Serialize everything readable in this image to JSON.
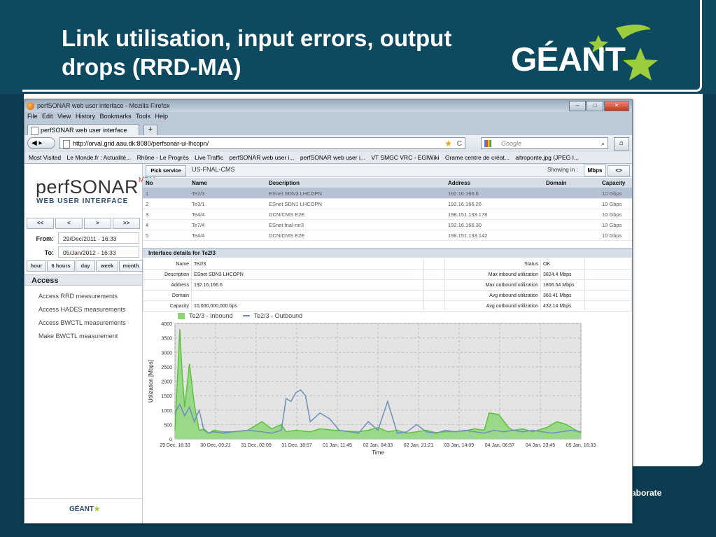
{
  "slide": {
    "title_line1": "Link utilisation, input errors, output",
    "title_line2": "drops (RRD-MA)",
    "logo": "GÉANT",
    "footer_fragment": "aborate"
  },
  "browser": {
    "window_title": "perfSONAR web user interface - Mozilla Firefox",
    "menu": [
      "File",
      "Edit",
      "View",
      "History",
      "Bookmarks",
      "Tools",
      "Help"
    ],
    "tab_label": "perfSONAR web user interface",
    "new_tab": "+",
    "url": "http://orval.grid.aau.dk:8080/perfsonar-ui-lhcopn/",
    "search_placeholder": "Google",
    "bookmarks": [
      "Most Visited",
      "Le Monde.fr : Actualité...",
      "Rhône - Le Progrès",
      "Live Traffic",
      "perfSONAR web user i...",
      "perfSONAR web user i...",
      "VT SMGC VRC - EGIWiki",
      "Grame centre de créat...",
      "altroponte.jpg (JPEG I..."
    ]
  },
  "sidebar": {
    "brand": "perfSONAR",
    "brand_sup": "MDM",
    "subtitle": "WEB USER INTERFACE",
    "nav": [
      "<<",
      "<",
      ">",
      ">>"
    ],
    "from_label": "From:",
    "from_value": "29/Dec/2011 - 16:33",
    "to_label": "To:",
    "to_value": "05/Jan/2012 - 16:33",
    "ranges": [
      "hour",
      "6 hours",
      "day",
      "week",
      "month"
    ],
    "access_title": "Access",
    "access_items": [
      "Access RRD measurements",
      "Access HADES measurements",
      "Access BWCTL measurements",
      "Make BWCTL measurement"
    ],
    "footer_logo": "GÉANT"
  },
  "service": {
    "pick_label": "Pick service",
    "name": "US-FNAL-CMS",
    "showing_label": "Showing in :",
    "unit": "Mbps",
    "swap": "<>"
  },
  "interfaces": {
    "headers": [
      "No",
      "Name",
      "Description",
      "Address",
      "Domain",
      "Capacity"
    ],
    "rows": [
      [
        "1",
        "Te2/3",
        "ESnet SDN3 LHCOPN",
        "192.16.166.6",
        "",
        "10 Gbps"
      ],
      [
        "2",
        "Te3/1",
        "ESnet SDN1 LHCOPN",
        "192.16.166.26",
        "",
        "10 Gbps"
      ],
      [
        "3",
        "Te4/4",
        "DCN/CMS E2E",
        "198.151.133.178",
        "",
        "10 Gbps"
      ],
      [
        "4",
        "Te7/4",
        "ESnet fnal-mr3",
        "192.16.166.30",
        "",
        "10 Gbps"
      ],
      [
        "5",
        "Te4/4",
        "DCN/CMS E2E",
        "198.151.133.142",
        "",
        "10 Gbps"
      ]
    ]
  },
  "details": {
    "title": "Interface details for Te2/3",
    "left": [
      {
        "k": "Name",
        "v": "Te2/3"
      },
      {
        "k": "Description",
        "v": "ESnet SDN3 LHCOPN"
      },
      {
        "k": "Address",
        "v": "192.16.166.6"
      },
      {
        "k": "Domain",
        "v": ""
      },
      {
        "k": "Capacity",
        "v": "10,000,000,000 bps"
      }
    ],
    "right": [
      {
        "k": "Status",
        "v": "OK"
      },
      {
        "k": "Max inbound utilization",
        "v": "3824.4 Mbps"
      },
      {
        "k": "Max outbound utilization",
        "v": "1806.54 Mbps"
      },
      {
        "k": "Avg inbound utilization",
        "v": "360.41 Mbps"
      },
      {
        "k": "Avg outbound utilization",
        "v": "432.14 Mbps"
      }
    ]
  },
  "chart_data": {
    "type": "area",
    "ylabel": "Utilization [Mbps]",
    "xlabel": "Time",
    "ylim": [
      0,
      4000
    ],
    "yticks": [
      0,
      500,
      1000,
      1500,
      2000,
      2500,
      3000,
      3500,
      4000
    ],
    "xticks": [
      "29 Dec, 16:33",
      "30 Dec, 09:21",
      "31 Dec, 02:09",
      "31 Dec, 18:57",
      "01 Jan, 11:45",
      "02 Jan, 04:33",
      "02 Jan, 21:21",
      "03 Jan, 14:09",
      "04 Jan, 06:57",
      "04 Jan, 23:45",
      "05 Jan, 16:33"
    ],
    "grid": true,
    "colors": {
      "inbound": "#5cc23a",
      "inbound_fill": "#9ad88a",
      "outbound": "#6f8fb8",
      "plot_bg": "#e4e4e4"
    },
    "series": [
      {
        "name": "Te2/3 - Inbound",
        "x_hours": [
          0,
          2,
          3,
          4,
          6,
          8,
          10,
          12,
          14,
          16,
          20,
          24,
          30,
          36,
          40,
          44,
          46,
          50,
          56,
          60,
          66,
          70,
          76,
          80,
          84,
          88,
          92,
          96,
          100,
          104,
          108,
          112,
          116,
          120,
          124,
          128,
          130,
          134,
          138,
          140,
          144,
          148,
          150,
          154,
          158,
          162,
          166,
          168
        ],
        "values": [
          300,
          3800,
          2200,
          1100,
          2600,
          1200,
          300,
          350,
          200,
          300,
          250,
          250,
          300,
          600,
          350,
          500,
          250,
          300,
          250,
          350,
          300,
          280,
          250,
          300,
          400,
          250,
          300,
          200,
          250,
          300,
          220,
          250,
          260,
          280,
          350,
          300,
          900,
          850,
          400,
          300,
          350,
          250,
          300,
          400,
          600,
          500,
          300,
          200
        ]
      },
      {
        "name": "Te2/3 - Outbound",
        "x_hours": [
          0,
          2,
          4,
          6,
          8,
          10,
          12,
          14,
          16,
          20,
          24,
          30,
          36,
          40,
          44,
          46,
          48,
          50,
          52,
          54,
          56,
          60,
          64,
          68,
          72,
          76,
          80,
          84,
          88,
          92,
          96,
          100,
          104,
          108,
          112,
          116,
          120,
          124,
          128,
          132,
          136,
          140,
          144,
          148,
          152,
          156,
          160,
          164,
          168
        ],
        "values": [
          900,
          1200,
          800,
          1100,
          600,
          1000,
          300,
          200,
          250,
          200,
          250,
          300,
          250,
          200,
          300,
          1400,
          1300,
          1600,
          1700,
          1500,
          600,
          900,
          700,
          300,
          250,
          200,
          600,
          300,
          1300,
          200,
          250,
          500,
          250,
          200,
          300,
          250,
          300,
          250,
          200,
          300,
          250,
          300,
          250,
          300,
          250,
          200,
          250,
          300,
          250
        ]
      }
    ]
  }
}
